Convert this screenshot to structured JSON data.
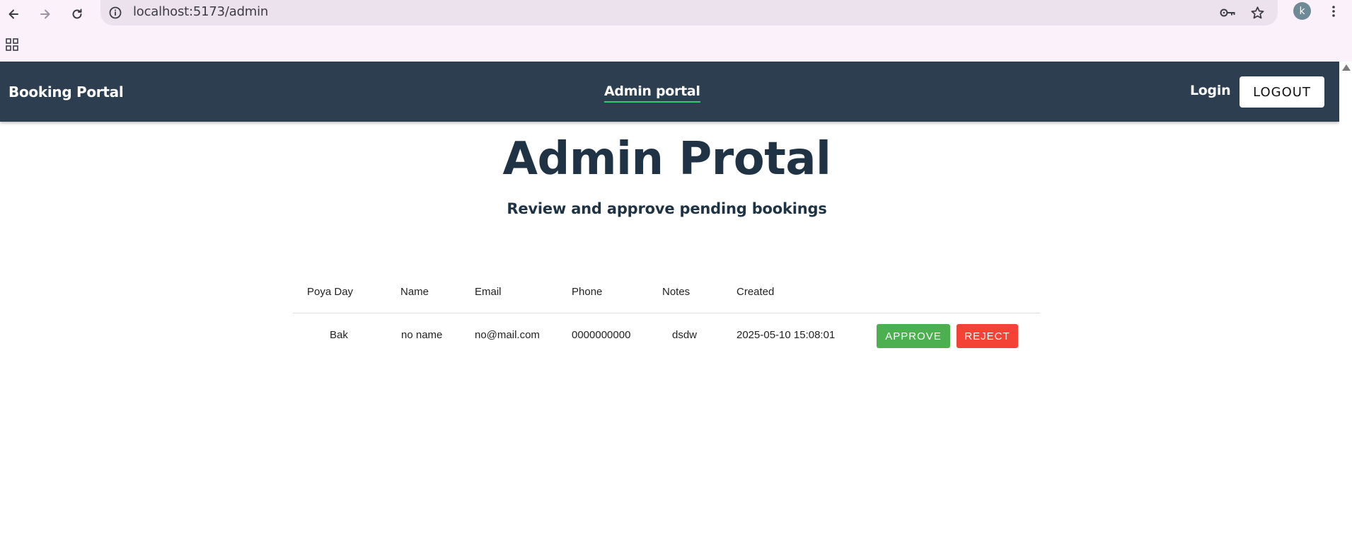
{
  "browser": {
    "url": "localhost:5173/admin",
    "profile_initial": "k",
    "icons": [
      "back-icon",
      "forward-icon",
      "reload-icon",
      "info-icon",
      "password-key-icon",
      "star-icon",
      "kebab-menu-icon",
      "apps-grid-icon"
    ]
  },
  "navbar": {
    "brand": "Booking Portal",
    "center_link": "Admin portal",
    "login": "Login",
    "logout": "LOGOUT"
  },
  "page": {
    "title": "Admin Protal",
    "subtitle": "Review and approve pending bookings"
  },
  "table": {
    "headers": [
      "Poya Day",
      "Name",
      "Email",
      "Phone",
      "Notes",
      "Created"
    ],
    "rows": [
      {
        "poya_day": "Bak",
        "name": "no name",
        "email": "no@mail.com",
        "phone": "0000000000",
        "notes": "dsdw",
        "created": "2025-05-10 15:08:01",
        "approve": "APPROVE",
        "reject": "REJECT"
      }
    ]
  },
  "colors": {
    "navbar_bg": "#2c3e50",
    "active_underline": "#2ecc71",
    "approve": "#4caf50",
    "reject": "#f44336",
    "title": "#1f3344"
  }
}
